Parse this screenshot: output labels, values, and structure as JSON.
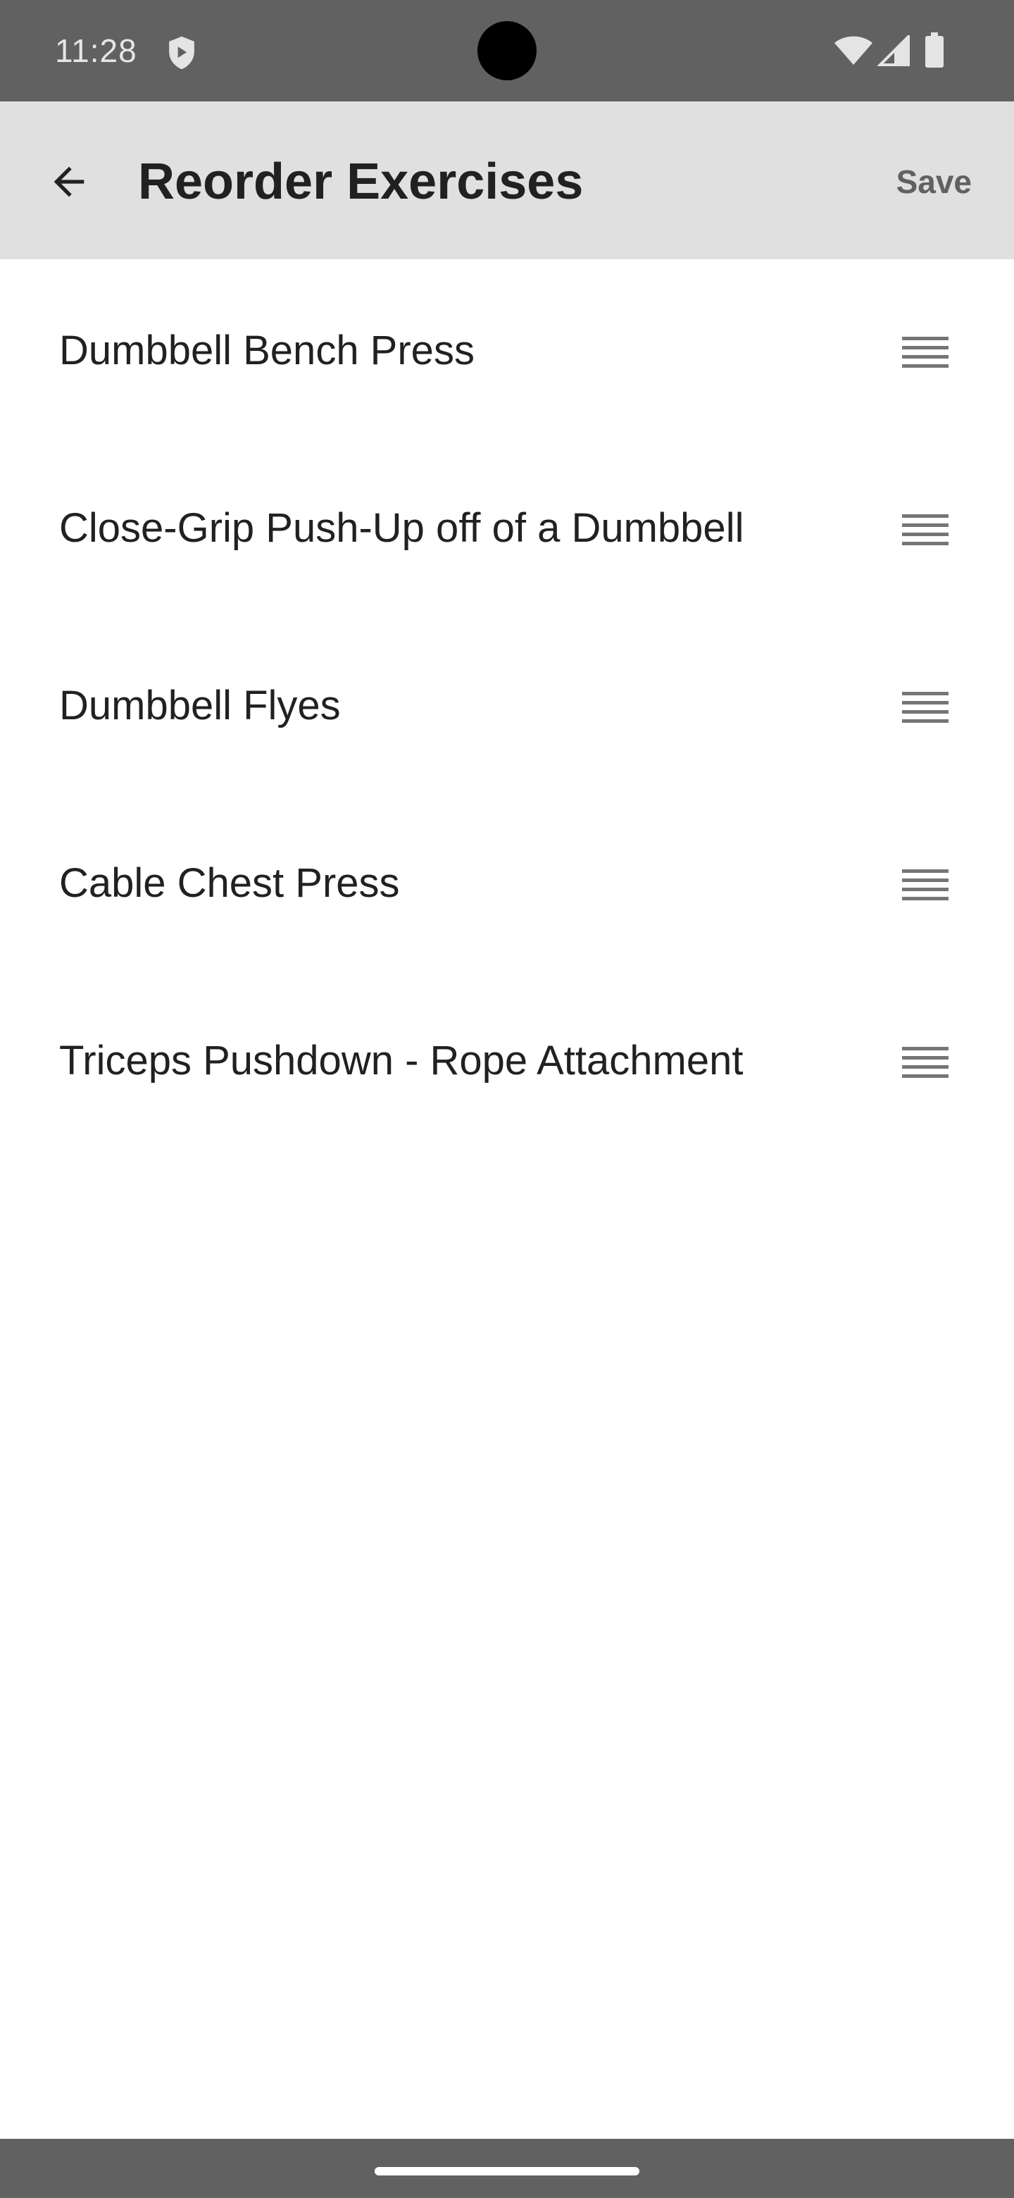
{
  "status_bar": {
    "time": "11:28",
    "icons": [
      "shield-icon",
      "wifi-icon",
      "cellular-signal-icon",
      "battery-icon"
    ]
  },
  "app_bar": {
    "back_icon": "arrow-back-icon",
    "title": "Reorder Exercises",
    "save_label": "Save"
  },
  "exercises": [
    {
      "label": "Dumbbell Bench Press",
      "handle_icon": "drag-handle-icon"
    },
    {
      "label": "Close-Grip Push-Up off of a Dumbbell",
      "handle_icon": "drag-handle-icon"
    },
    {
      "label": "Dumbbell Flyes",
      "handle_icon": "drag-handle-icon"
    },
    {
      "label": "Cable Chest Press",
      "handle_icon": "drag-handle-icon"
    },
    {
      "label": "Triceps Pushdown - Rope Attachment",
      "handle_icon": "drag-handle-icon"
    }
  ],
  "colors": {
    "status_bar": "#616161",
    "app_bar": "#e0e0e0",
    "text_primary": "#212121",
    "text_secondary": "#616161",
    "background": "#ffffff"
  }
}
